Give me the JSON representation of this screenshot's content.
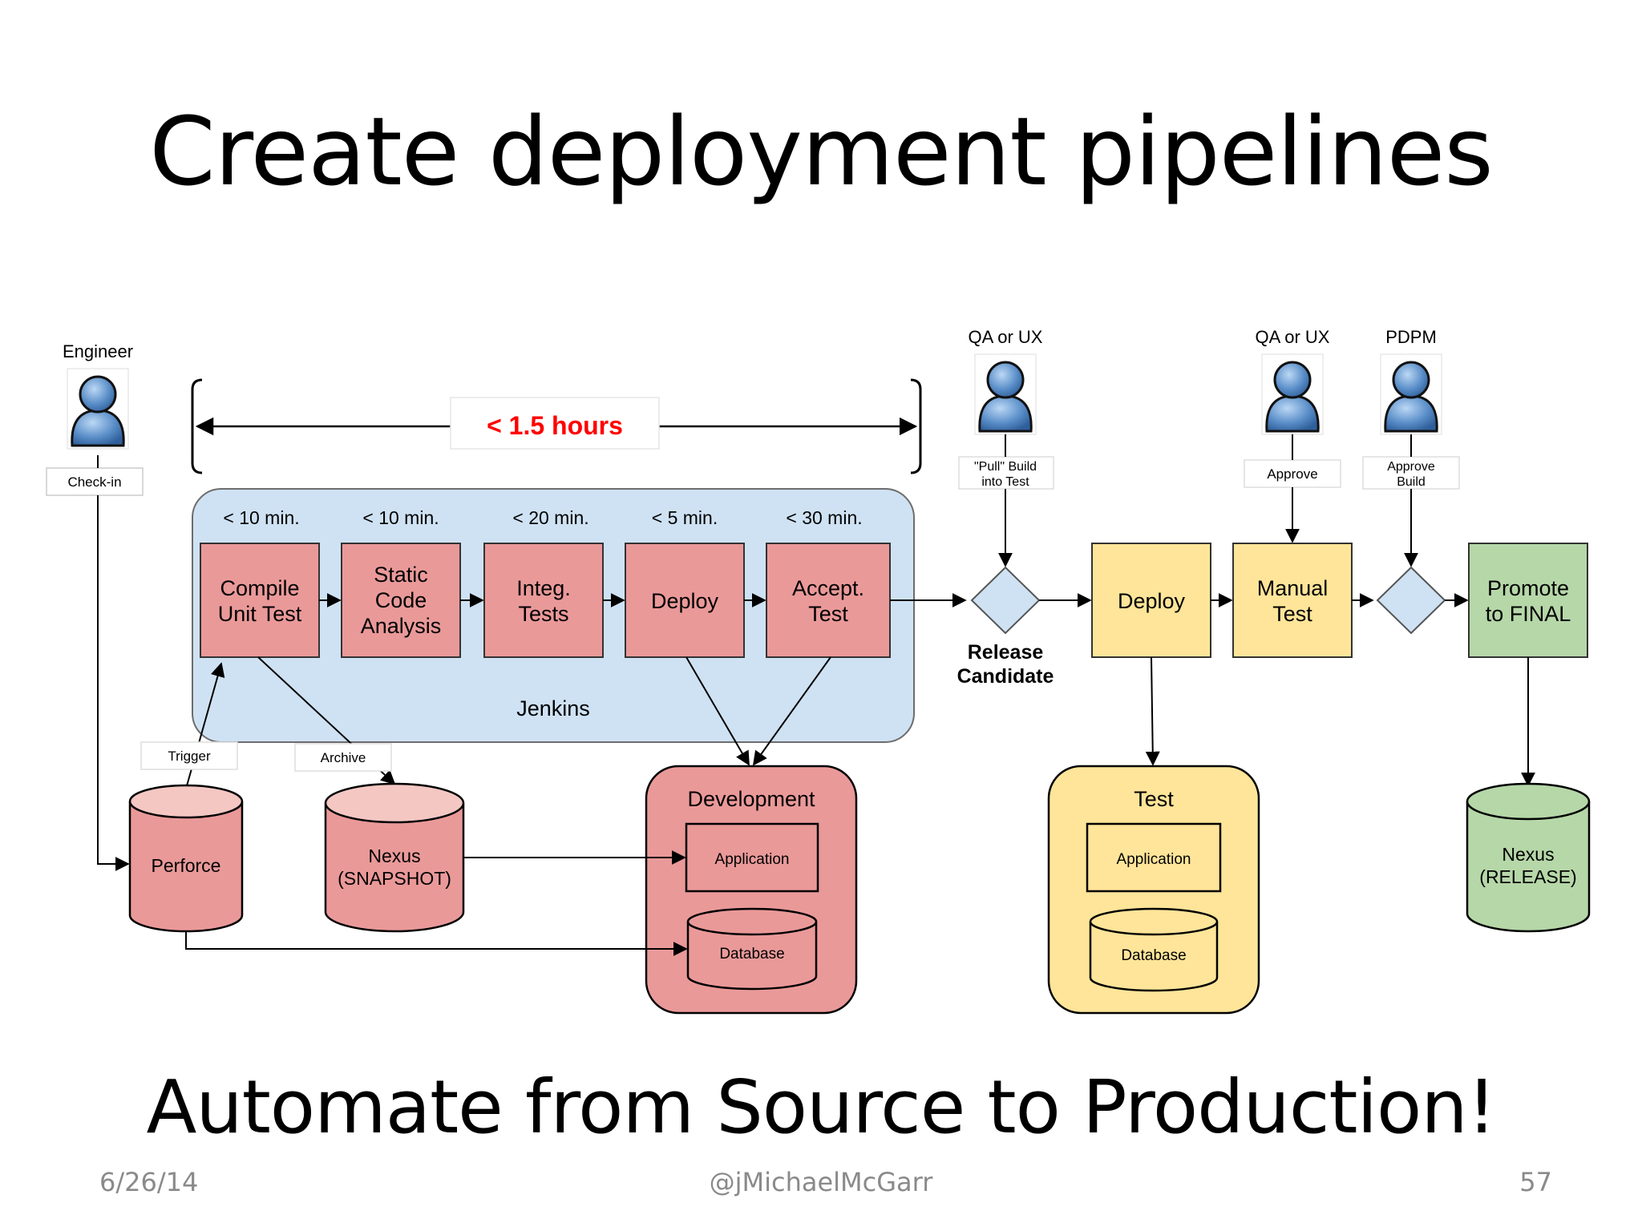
{
  "slide": {
    "title": "Create deployment pipelines",
    "subtitle": "Automate from Source to Production!",
    "footer_date": "6/26/14",
    "footer_author": "@jMichaelMcGarr",
    "footer_page": "57"
  },
  "diagram": {
    "engineer_label": "Engineer",
    "checkin_label": "Check-in",
    "duration_label": "< 1.5 hours",
    "jenkins_label": "Jenkins",
    "stages": [
      {
        "time": "< 10 min.",
        "line1": "Compile",
        "line2": "Unit Test",
        "line3": ""
      },
      {
        "time": "< 10 min.",
        "line1": "Static",
        "line2": "Code",
        "line3": "Analysis"
      },
      {
        "time": "< 20 min.",
        "line1": "Integ.",
        "line2": "Tests",
        "line3": ""
      },
      {
        "time": "< 5 min.",
        "line1": "Deploy",
        "line2": "",
        "line3": ""
      },
      {
        "time": "< 30 min.",
        "line1": "Accept.",
        "line2": "Test",
        "line3": ""
      }
    ],
    "trigger_label": "Trigger",
    "archive_label": "Archive",
    "perforce_label": "Perforce",
    "nexus_snapshot_line1": "Nexus",
    "nexus_snapshot_line2": "(SNAPSHOT)",
    "development_label": "Development",
    "dev_application": "Application",
    "dev_database": "Database",
    "qa1_label": "QA or UX",
    "pull_line1": "\"Pull\" Build",
    "pull_line2": "into Test",
    "release_line1": "Release",
    "release_line2": "Candidate",
    "deploy_label": "Deploy",
    "test_env_label": "Test",
    "test_application": "Application",
    "test_database": "Database",
    "qa2_label": "QA or UX",
    "approve_label": "Approve",
    "manual_line1": "Manual",
    "manual_line2": "Test",
    "pdpm_label": "PDPM",
    "approve_build_line1": "Approve",
    "approve_build_line2": "Build",
    "promote_line1": "Promote",
    "promote_line2": "to FINAL",
    "nexus_release_line1": "Nexus",
    "nexus_release_line2": "(RELEASE)"
  },
  "colors": {
    "red_box": "#ea9999",
    "yellow_box": "#ffe599",
    "green_box": "#b6d7a8",
    "jenkins_bg": "#cfe2f3",
    "accent_red": "#ff0000"
  }
}
